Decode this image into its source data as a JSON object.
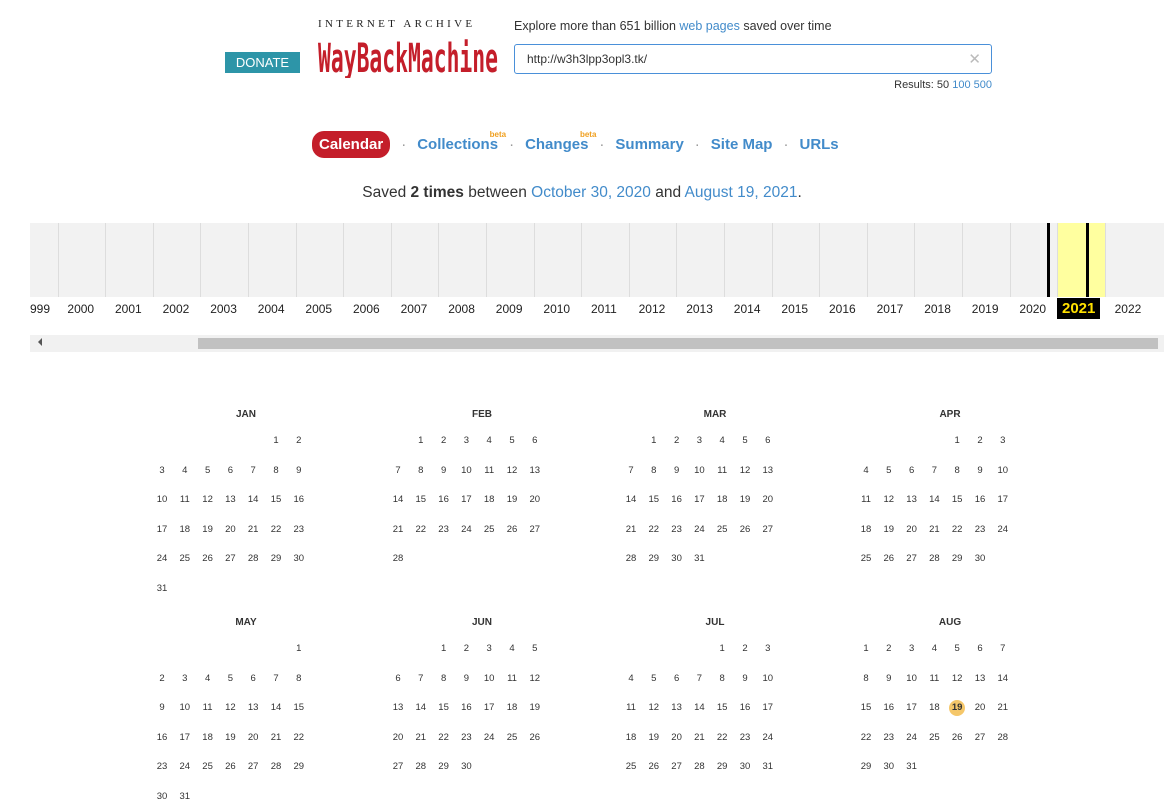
{
  "header": {
    "donate_label": "DONATE",
    "logo_top": "INTERNET ARCHIVE",
    "logo_main": "WayBackMachine",
    "tagline_pre": "Explore more than 651 billion ",
    "tagline_link": "web pages",
    "tagline_post": " saved over time",
    "url_value": "http://w3h3lpp3opl3.tk/",
    "results_label": "Results: 50",
    "results_100": "100",
    "results_500": "500"
  },
  "nav": {
    "tabs": [
      {
        "label": "Calendar",
        "active": true,
        "beta": false
      },
      {
        "label": "Collections",
        "active": false,
        "beta": true
      },
      {
        "label": "Changes",
        "active": false,
        "beta": true
      },
      {
        "label": "Summary",
        "active": false,
        "beta": false
      },
      {
        "label": "Site Map",
        "active": false,
        "beta": false
      },
      {
        "label": "URLs",
        "active": false,
        "beta": false
      }
    ],
    "separator": "·",
    "beta_label": "beta"
  },
  "saved": {
    "pre": "Saved ",
    "count": "2 times",
    "mid": " between ",
    "start": "October 30, 2020",
    "and": " and ",
    "end": "August 19, 2021",
    "post": "."
  },
  "timeline": {
    "years": [
      "999",
      "2000",
      "2001",
      "2002",
      "2003",
      "2004",
      "2005",
      "2006",
      "2007",
      "2008",
      "2009",
      "2010",
      "2011",
      "2012",
      "2013",
      "2014",
      "2015",
      "2016",
      "2017",
      "2018",
      "2019",
      "2020",
      "2021",
      "2022"
    ],
    "current_year": "2021",
    "highlight_color": "#ffff9f",
    "capture_years": [
      "2020",
      "2021"
    ]
  },
  "calendar": {
    "year": 2021,
    "captures": [
      {
        "month": "AUG",
        "day": 19
      }
    ],
    "months": [
      {
        "name": "JAN",
        "first_weekday": 5,
        "days": 31
      },
      {
        "name": "FEB",
        "first_weekday": 1,
        "days": 28
      },
      {
        "name": "MAR",
        "first_weekday": 1,
        "days": 31
      },
      {
        "name": "APR",
        "first_weekday": 4,
        "days": 30
      },
      {
        "name": "MAY",
        "first_weekday": 6,
        "days": 31
      },
      {
        "name": "JUN",
        "first_weekday": 2,
        "days": 30
      },
      {
        "name": "JUL",
        "first_weekday": 4,
        "days": 31
      },
      {
        "name": "AUG",
        "first_weekday": 0,
        "days": 31
      }
    ]
  },
  "colors": {
    "accent_red": "#c41e2a",
    "link_blue": "#428bca",
    "donate_teal": "#2d95a8",
    "capture_dot": "#f5c76a",
    "current_year_text": "#ffe000"
  }
}
